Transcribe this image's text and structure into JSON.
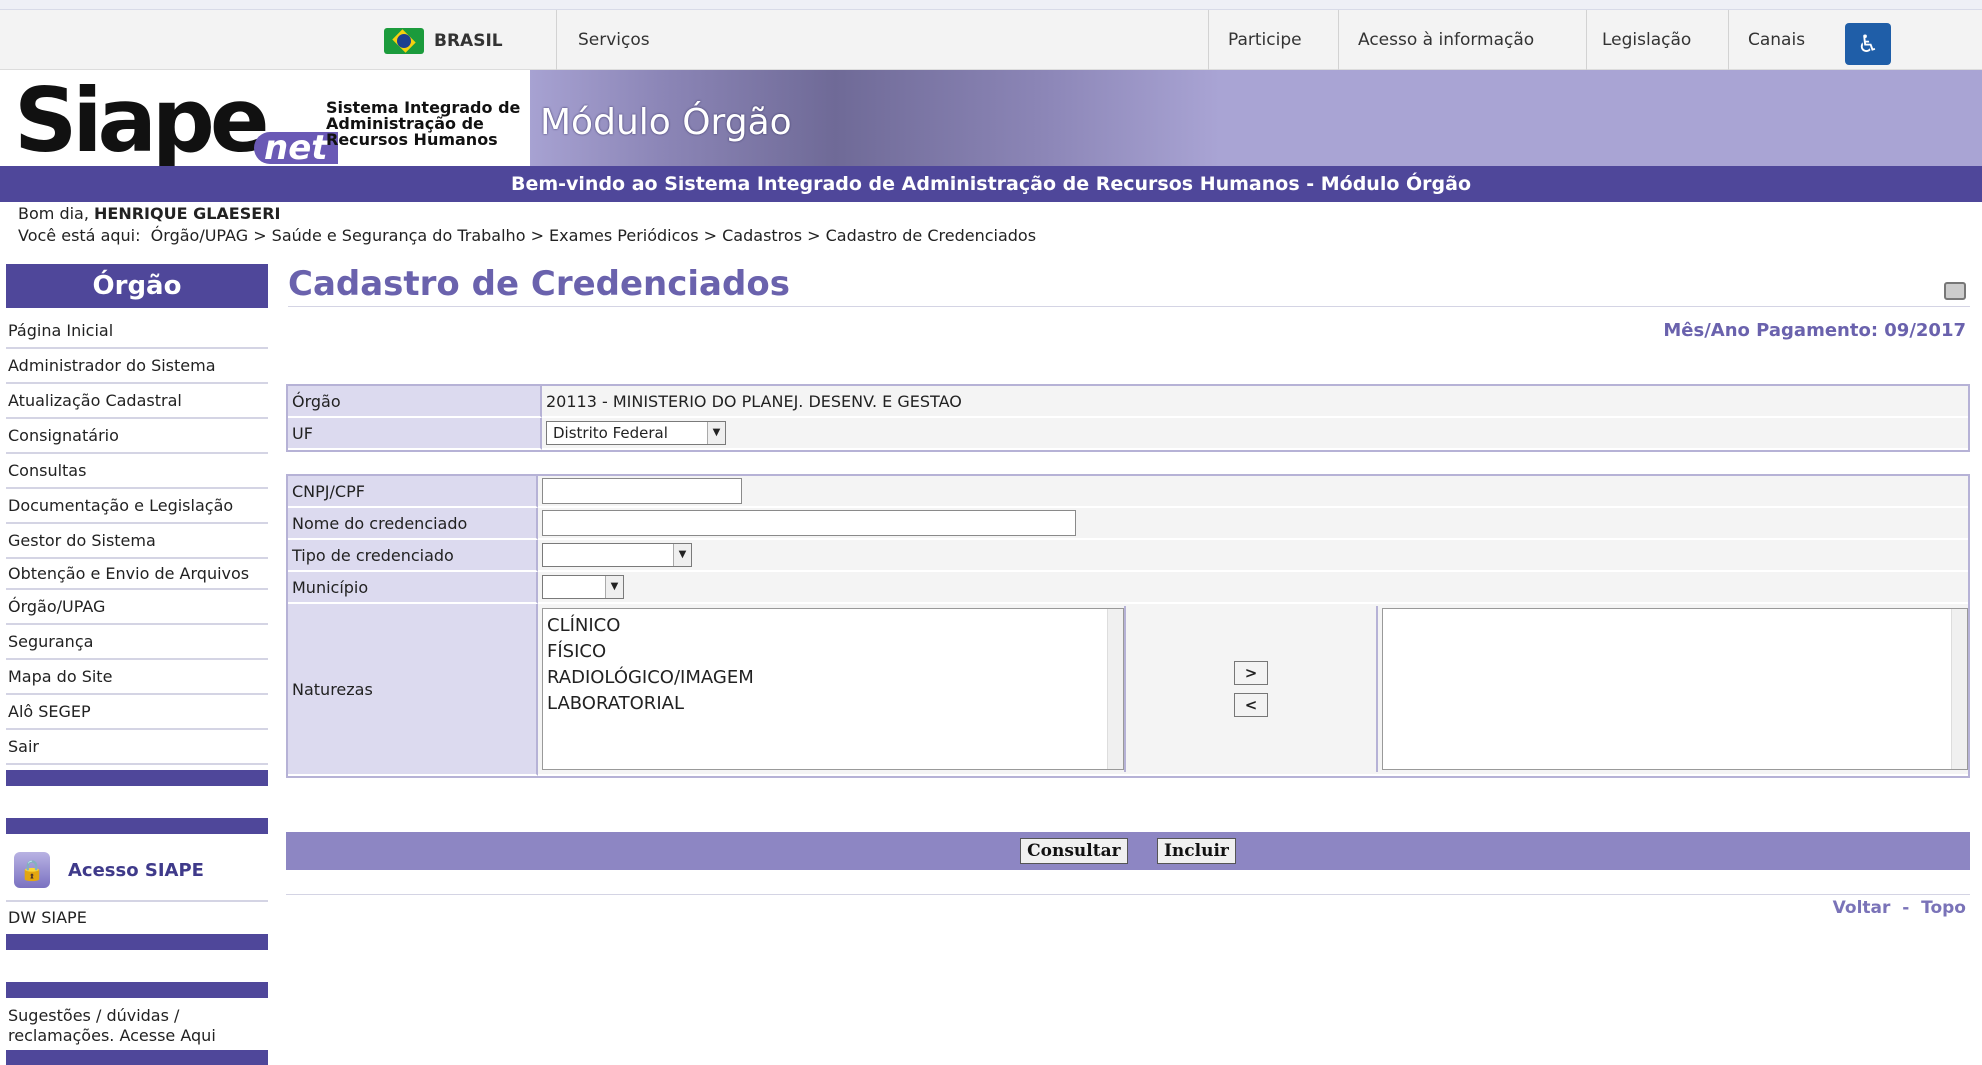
{
  "govbar": {
    "brasil": "BRASIL",
    "servicos": "Serviços",
    "participe": "Participe",
    "acesso_info": "Acesso à informação",
    "legislacao": "Legislação",
    "canais": "Canais"
  },
  "banner": {
    "logo": "Siape",
    "logo_net": "net",
    "logo_sub": [
      "Sistema Integrado de",
      "Administração de",
      "Recursos Humanos"
    ],
    "modulo": "Módulo Órgão",
    "welcome": "Bem-vindo ao Sistema Integrado de Administração de Recursos Humanos - Módulo Órgão"
  },
  "user": {
    "greeting_prefix": "Bom dia, ",
    "name": "HENRIQUE GLAESERI",
    "breadcrumb_prefix": "Você está aqui:",
    "breadcrumb": "Órgão/UPAG > Saúde e Segurança do Trabalho > Exames Periódicos > Cadastros > Cadastro de Credenciados"
  },
  "sidebar": {
    "title": "Órgão",
    "items": [
      "Página Inicial",
      "Administrador do Sistema",
      "Atualização Cadastral",
      "Consignatário",
      "Consultas",
      "Documentação e Legislação",
      "Gestor do Sistema",
      "Obtenção e Envio de Arquivos",
      "Órgão/UPAG",
      "Segurança",
      "Mapa do Site",
      "Alô SEGEP",
      "Sair"
    ],
    "acesso_siape": "Acesso SIAPE",
    "dw_siape": "DW SIAPE",
    "sugestoes": "Sugestões / dúvidas / reclamações. Acesse Aqui"
  },
  "main": {
    "title": "Cadastro de Credenciados",
    "mes_ano": "Mês/Ano Pagamento: 09/2017",
    "orgao_label": "Órgão",
    "orgao_value": "20113 - MINISTERIO DO PLANEJ. DESENV. E GESTAO",
    "uf_label": "UF",
    "uf_value": "Distrito Federal",
    "cnpj_label": "CNPJ/CPF",
    "cnpj_value": "",
    "nome_label": "Nome do credenciado",
    "nome_value": "",
    "tipo_label": "Tipo de credenciado",
    "tipo_value": "",
    "municipio_label": "Município",
    "municipio_value": "",
    "naturezas_label": "Naturezas",
    "naturezas_options": [
      "CLÍNICO",
      "FÍSICO",
      "RADIOLÓGICO/IMAGEM",
      "LABORATORIAL"
    ],
    "move_right": ">",
    "move_left": "<",
    "consultar": "Consultar",
    "incluir": "Incluir",
    "voltar": "Voltar",
    "topo": "Topo",
    "link_sep": "-"
  }
}
